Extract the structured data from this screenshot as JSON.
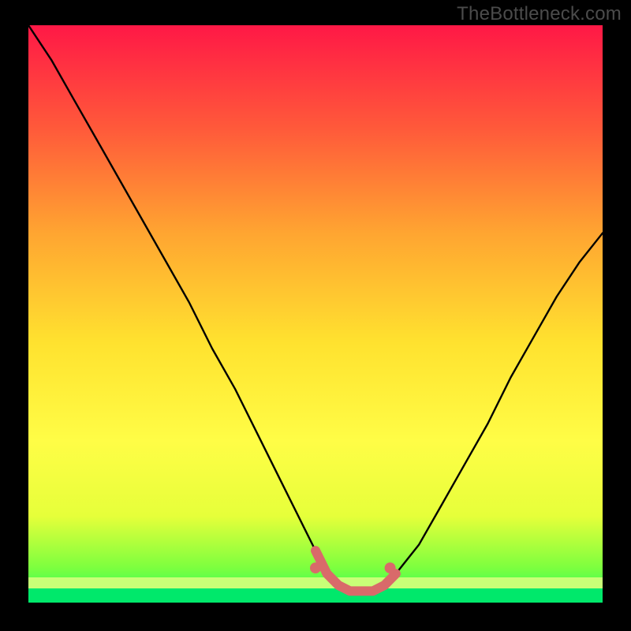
{
  "page": {
    "watermark": "TheBottleneck.com"
  },
  "colors": {
    "background": "#000000",
    "watermark": "#4b4b4b",
    "curve": "#000000",
    "marker": "#d96a6a",
    "gradient_stops": [
      "#ff1846",
      "#ff5a3a",
      "#ffa531",
      "#ffe22f",
      "#fffd46",
      "#e6ff3a",
      "#7cff3f",
      "#1bff60"
    ],
    "bottom_band_a": "#c8ff77",
    "bottom_band_b": "#00e86b"
  },
  "chart_data": {
    "type": "line",
    "title": "",
    "xlabel": "",
    "ylabel": "",
    "xlim": [
      0,
      100
    ],
    "ylim": [
      0,
      100
    ],
    "curve": {
      "x": [
        0,
        4,
        8,
        12,
        16,
        20,
        24,
        28,
        32,
        36,
        40,
        44,
        48,
        50,
        52,
        54,
        56,
        58,
        60,
        62,
        64,
        68,
        72,
        76,
        80,
        84,
        88,
        92,
        96,
        100
      ],
      "y": [
        100,
        94,
        87,
        80,
        73,
        66,
        59,
        52,
        44,
        37,
        29,
        21,
        13,
        9,
        5,
        3,
        2,
        2,
        2,
        3,
        5,
        10,
        17,
        24,
        31,
        39,
        46,
        53,
        59,
        64
      ]
    },
    "flat_region": {
      "description": "near-zero plateau highlighted in salmon",
      "x_start": 50,
      "x_end": 63,
      "y": 2
    }
  }
}
